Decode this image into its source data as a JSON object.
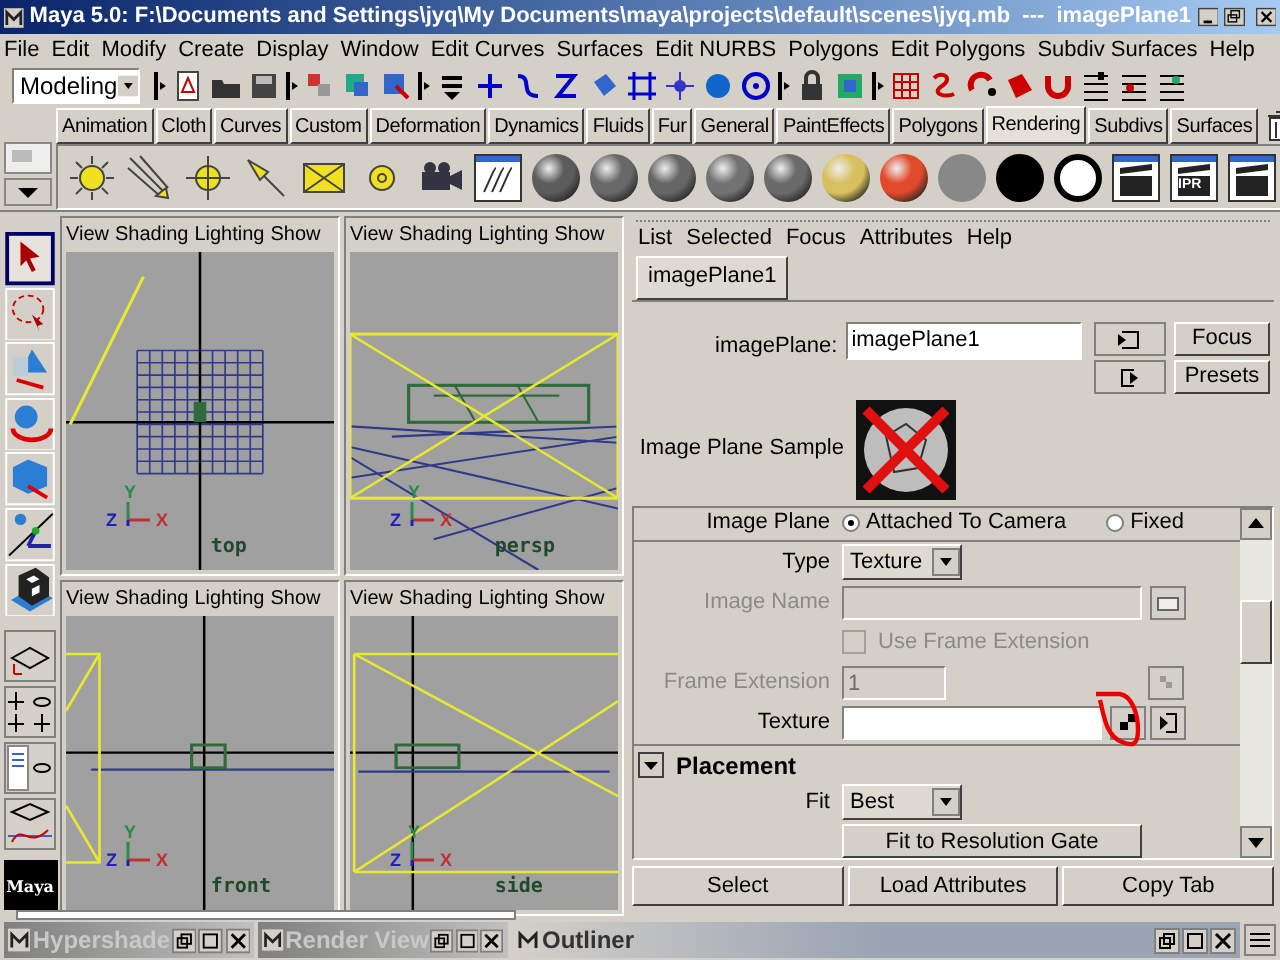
{
  "window": {
    "title": "Maya 5.0: F:\\Documents and Settings\\jyq\\My Documents\\maya\\projects\\default\\scenes\\jyq.mb  ---  imagePlane1"
  },
  "menu_bar": [
    "File",
    "Edit",
    "Modify",
    "Create",
    "Display",
    "Window",
    "Edit Curves",
    "Surfaces",
    "Edit NURBS",
    "Polygons",
    "Edit Polygons",
    "Subdiv Surfaces",
    "Help"
  ],
  "status_line": {
    "mode": "Modeling"
  },
  "shelf": {
    "tabs": [
      {
        "label": "Animation",
        "selected": false
      },
      {
        "label": "Cloth",
        "selected": false
      },
      {
        "label": "Curves",
        "selected": false
      },
      {
        "label": "Custom",
        "selected": false
      },
      {
        "label": "Deformation",
        "selected": false
      },
      {
        "label": "Dynamics",
        "selected": false
      },
      {
        "label": "Fluids",
        "selected": false
      },
      {
        "label": "Fur",
        "selected": false
      },
      {
        "label": "General",
        "selected": false
      },
      {
        "label": "PaintEffects",
        "selected": false
      },
      {
        "label": "Polygons",
        "selected": false
      },
      {
        "label": "Rendering",
        "selected": true
      },
      {
        "label": "Subdivs",
        "selected": false
      },
      {
        "label": "Surfaces",
        "selected": false
      }
    ],
    "items": [
      {
        "kind": "sun"
      },
      {
        "kind": "directional"
      },
      {
        "kind": "point"
      },
      {
        "kind": "spot"
      },
      {
        "kind": "area"
      },
      {
        "kind": "volume"
      },
      {
        "kind": "camera"
      },
      {
        "kind": "texture"
      },
      {
        "kind": "sphere",
        "color": "#5c5c5c"
      },
      {
        "kind": "sphere",
        "color": "#686868"
      },
      {
        "kind": "sphere",
        "color": "#666666"
      },
      {
        "kind": "sphere",
        "color": "#727272"
      },
      {
        "kind": "sphere",
        "color": "#6a6a6a"
      },
      {
        "kind": "sphere",
        "color": "#d8c060"
      },
      {
        "kind": "sphere",
        "color": "#e04a2a"
      },
      {
        "kind": "disc",
        "color": "#888888"
      },
      {
        "kind": "disc",
        "color": "#000000"
      },
      {
        "kind": "ring",
        "color": "#ffffff"
      },
      {
        "kind": "clapper"
      },
      {
        "kind": "clapper",
        "label": "IPR"
      },
      {
        "kind": "clapper"
      }
    ]
  },
  "tools": [
    {
      "kind": "select",
      "selected": true
    },
    {
      "kind": "lasso",
      "selected": false
    },
    {
      "kind": "move",
      "selected": false
    },
    {
      "kind": "rotate",
      "selected": false
    },
    {
      "kind": "scale",
      "selected": false
    },
    {
      "kind": "manipulator",
      "selected": false
    },
    {
      "kind": "last",
      "selected": false
    }
  ],
  "logo": "Maya",
  "viewports": [
    {
      "kind": "top",
      "menus": [
        "View",
        "Shading",
        "Lighting",
        "Show"
      ],
      "label": "top",
      "axes": [
        "Y",
        "Z",
        "X"
      ]
    },
    {
      "kind": "persp",
      "menus": [
        "View",
        "Shading",
        "Lighting",
        "Show"
      ],
      "label": "persp",
      "axes": [
        "Y",
        "Z",
        "X"
      ]
    },
    {
      "kind": "front",
      "menus": [
        "View",
        "Shading",
        "Lighting",
        "Show"
      ],
      "label": "front",
      "axes": [
        "Y",
        "Z",
        "X"
      ]
    },
    {
      "kind": "side",
      "menus": [
        "View",
        "Shading",
        "Lighting",
        "Show"
      ],
      "label": "side",
      "axes": [
        "Y",
        "Z",
        "X"
      ]
    }
  ],
  "attribute_editor": {
    "menus": [
      "List",
      "Selected",
      "Focus",
      "Attributes",
      "Help"
    ],
    "tabs": [
      {
        "label": "imagePlane1",
        "selected": true
      }
    ],
    "node_label": "imagePlane:",
    "node_name": "imagePlane1",
    "buttons": [
      "Focus",
      "Presets"
    ],
    "sample_label": "Image Plane Sample",
    "image_plane": {
      "label": "Image Plane",
      "options": [
        {
          "label": "Attached To Camera",
          "selected": true
        },
        {
          "label": "Fixed",
          "selected": false
        }
      ]
    },
    "fields": [
      {
        "kind": "dropdown",
        "label": "Type",
        "value": "Texture",
        "disabled": false
      },
      {
        "kind": "file",
        "label": "Image Name",
        "disabled": true
      },
      {
        "kind": "checkbox",
        "label": "Use Frame Extension",
        "checked": false,
        "disabled": true
      },
      {
        "kind": "number",
        "label": "Frame Extension",
        "value": "1",
        "disabled": true
      },
      {
        "kind": "texture",
        "label": "Texture",
        "disabled": false,
        "circled": true
      }
    ],
    "section": {
      "title": "Placement",
      "expanded": true
    },
    "placement_fields": [
      {
        "kind": "dropdown",
        "label": "Fit",
        "value": "Best",
        "disabled": false
      }
    ],
    "placement_button": "Fit to Resolution Gate",
    "footer_buttons": [
      "Select",
      "Load Attributes",
      "Copy Tab"
    ]
  },
  "taskbar": [
    {
      "title": "Hypershade",
      "active": false
    },
    {
      "title": "Render View",
      "active": false
    },
    {
      "title": "Outliner",
      "active": true
    }
  ]
}
